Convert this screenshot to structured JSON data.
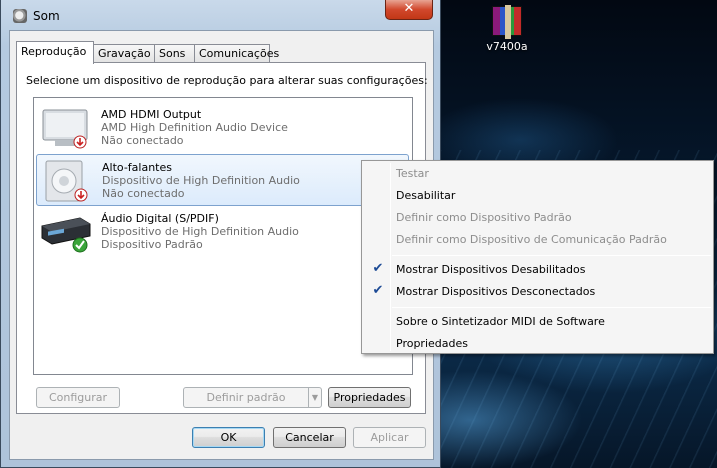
{
  "window": {
    "title": "Som",
    "close_glyph": "✕"
  },
  "tabs": [
    {
      "label": "Reprodução"
    },
    {
      "label": "Gravação"
    },
    {
      "label": "Sons"
    },
    {
      "label": "Comunicações"
    }
  ],
  "instruction": "Selecione um dispositivo de reprodução para alterar suas configurações:",
  "devices": [
    {
      "name": "AMD HDMI Output",
      "line1": "AMD High Definition Audio Device",
      "line2": "Não conectado",
      "icon": "monitor-icon",
      "status_icon": "disconnected-icon"
    },
    {
      "name": "Alto-falantes",
      "line1": "Dispositivo de High Definition Audio",
      "line2": "Não conectado",
      "icon": "speaker-icon",
      "status_icon": "disconnected-icon"
    },
    {
      "name": "Áudio Digital (S/PDIF)",
      "line1": "Dispositivo de High Definition Audio",
      "line2": "Dispositivo Padrão",
      "icon": "digital-audio-icon",
      "status_icon": "default-check-icon"
    }
  ],
  "buttons": {
    "configurar": "Configurar",
    "definir_padrao": "Definir padrão",
    "split_arrow": "▼",
    "propriedades": "Propriedades",
    "ok": "OK",
    "cancelar": "Cancelar",
    "aplicar": "Aplicar"
  },
  "context_menu": {
    "check_glyph": "✔",
    "items": [
      {
        "label": "Testar"
      },
      {
        "label": "Desabilitar"
      },
      {
        "label": "Definir como Dispositivo Padrão"
      },
      {
        "label": "Definir como Dispositivo de Comunicação Padrão"
      },
      {
        "label": "Mostrar Dispositivos Desabilitados"
      },
      {
        "label": "Mostrar Dispositivos Desconectados"
      },
      {
        "label": "Sobre o Sintetizador MIDI de Software"
      },
      {
        "label": "Propriedades"
      }
    ]
  },
  "desktop": {
    "icon_label": "v7400a",
    "icon": "winrar-archive-icon"
  }
}
